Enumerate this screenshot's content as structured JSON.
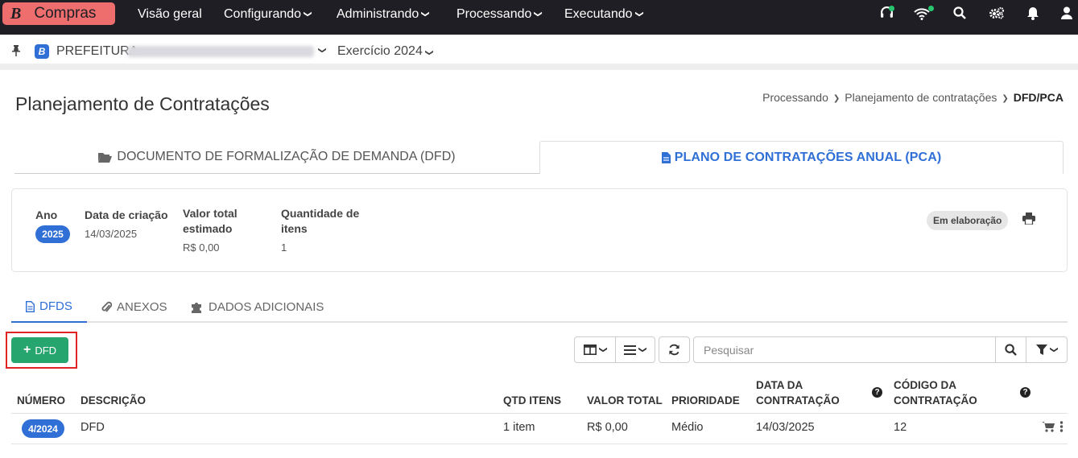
{
  "app": {
    "brand_letter": "B",
    "name": "Compras"
  },
  "nav": [
    {
      "label": "Visão geral",
      "caret": ""
    },
    {
      "label": "Configurando",
      "caret": "❯"
    },
    {
      "label": "Administrando",
      "caret": "❯"
    },
    {
      "label": "Processando",
      "caret": "❯"
    },
    {
      "label": "Executando",
      "caret": "❯"
    }
  ],
  "top_icons": [
    "headset-icon",
    "wifi-icon",
    "search-icon",
    "gears-icon",
    "bell-icon",
    "user-icon"
  ],
  "context": {
    "entity": "PREFEITURA",
    "exercise": "Exercício 2024"
  },
  "page": {
    "title": "Planejamento de Contratações",
    "breadcrumb": [
      "Processando",
      "Planejamento de contratações",
      "DFD/PCA"
    ]
  },
  "top_tabs": [
    {
      "label": "DOCUMENTO DE FORMALIZAÇÃO DE DEMANDA (DFD)",
      "icon": "folder-open-icon"
    },
    {
      "label": "PLANO DE CONTRATAÇÕES ANUAL (PCA)",
      "icon": "file-icon"
    }
  ],
  "summary": {
    "year_label": "Ano",
    "year": "2025",
    "created_label": "Data de criação",
    "created": "14/03/2025",
    "total_label_1": "Valor total",
    "total_label_2": "estimado",
    "total": "R$ 0,00",
    "qty_label_1": "Quantidade de",
    "qty_label_2": "itens",
    "qty": "1",
    "status": "Em elaboração"
  },
  "sub_tabs": [
    {
      "label": "DFDS",
      "icon": "file-icon"
    },
    {
      "label": "ANEXOS",
      "icon": "paperclip-icon"
    },
    {
      "label": "DADOS ADICIONAIS",
      "icon": "puzzle-icon"
    }
  ],
  "toolbar": {
    "add_label": "DFD",
    "search_placeholder": "Pesquisar"
  },
  "table": {
    "headers": {
      "numero": "NÚMERO",
      "descricao": "DESCRIÇÃO",
      "qtd": "QTD ITENS",
      "valor": "VALOR TOTAL",
      "prioridade": "PRIORIDADE",
      "data_1": "DATA DA",
      "data_2": "CONTRATAÇÃO",
      "codigo_1": "CÓDIGO DA",
      "codigo_2": "CONTRATAÇÃO"
    },
    "rows": [
      {
        "numero": "4/2024",
        "descricao": "DFD",
        "qtd": "1 item",
        "valor": "R$ 0,00",
        "prioridade": "Médio",
        "data": "14/03/2025",
        "codigo": "12"
      }
    ]
  }
}
